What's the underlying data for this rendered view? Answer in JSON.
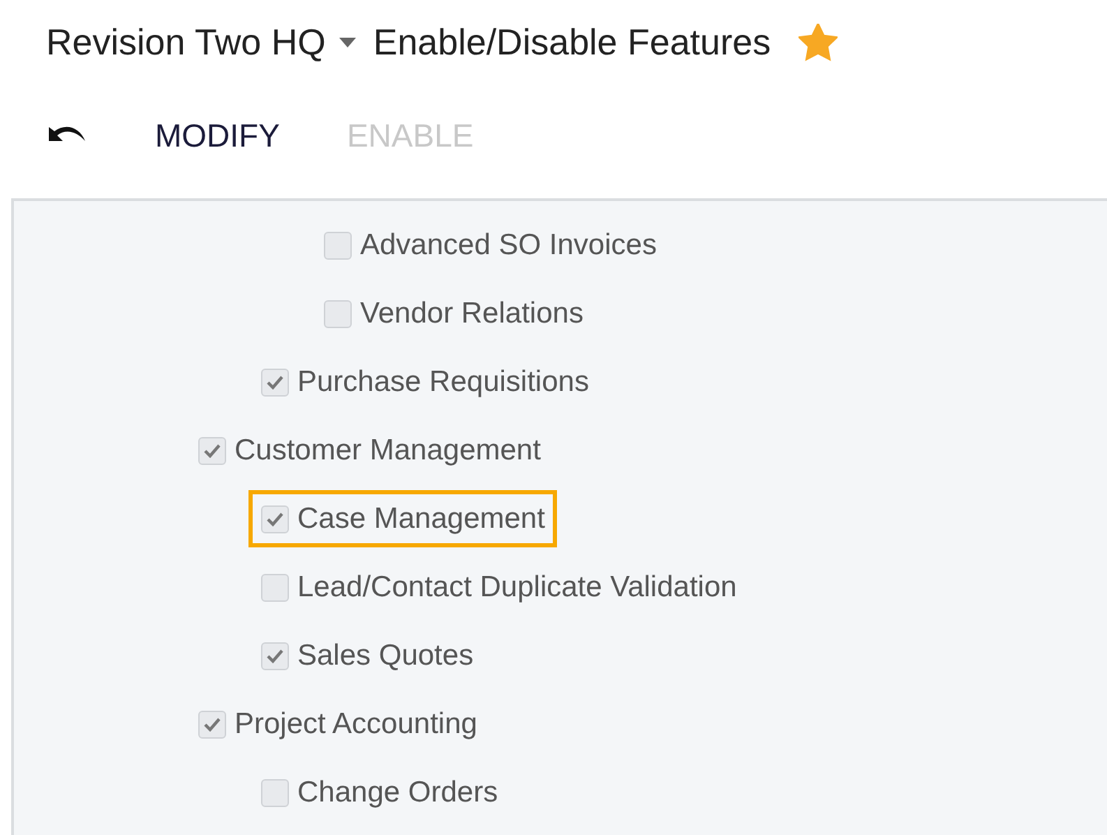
{
  "header": {
    "company": "Revision Two HQ",
    "title": "Enable/Disable Features",
    "favorite": true
  },
  "toolbar": {
    "buttons": [
      {
        "label": "MODIFY",
        "disabled": false
      },
      {
        "label": "ENABLE",
        "disabled": true
      }
    ]
  },
  "features": [
    {
      "children": [
        {
          "children": [
            {
              "label": "Advanced SO Invoices",
              "checked": false,
              "highlighted": false
            },
            {
              "label": "Vendor Relations",
              "checked": false,
              "highlighted": false
            }
          ]
        },
        {
          "label": "Purchase Requisitions",
          "checked": true,
          "highlighted": false
        }
      ]
    },
    {
      "label": "Customer Management",
      "checked": true,
      "highlighted": false,
      "children": [
        {
          "label": "Case Management",
          "checked": true,
          "highlighted": true
        },
        {
          "label": "Lead/Contact Duplicate Validation",
          "checked": false,
          "highlighted": false
        },
        {
          "label": "Sales Quotes",
          "checked": true,
          "highlighted": false
        }
      ]
    },
    {
      "label": "Project Accounting",
      "checked": true,
      "highlighted": false,
      "children": [
        {
          "label": "Change Orders",
          "checked": false,
          "highlighted": false
        }
      ]
    }
  ]
}
